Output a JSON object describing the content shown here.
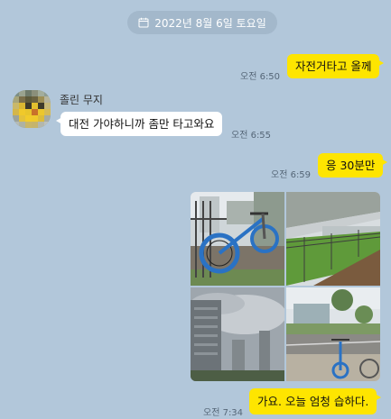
{
  "date_separator": {
    "text": "2022년 8월 6일 토요일",
    "icon": "calendar-icon"
  },
  "messages": [
    {
      "id": "m1",
      "from": "me",
      "text": "자전거타고 올께",
      "time": "오전 6:50"
    },
    {
      "id": "m2",
      "from": "friend",
      "sender": "졸린 무지",
      "text": "대전 가야하니까 좀만 타고와요",
      "time": "오전 6:55"
    },
    {
      "id": "m3",
      "from": "me",
      "text": "응 30분만",
      "time": "오전 6:59"
    },
    {
      "id": "m4",
      "from": "me",
      "type": "photos",
      "photos": [
        "bicycle-photo",
        "bridge-walkway-photo",
        "apartment-sky-photo",
        "street-bicycle-photo"
      ]
    },
    {
      "id": "m5",
      "from": "me",
      "text": "가요. 오늘 엄청 습하다.",
      "time": "오전 7:34"
    }
  ],
  "colors": {
    "background": "#b2c7da",
    "my_bubble": "#fee500",
    "their_bubble": "#ffffff",
    "date_pill": "#a3b8cb"
  }
}
